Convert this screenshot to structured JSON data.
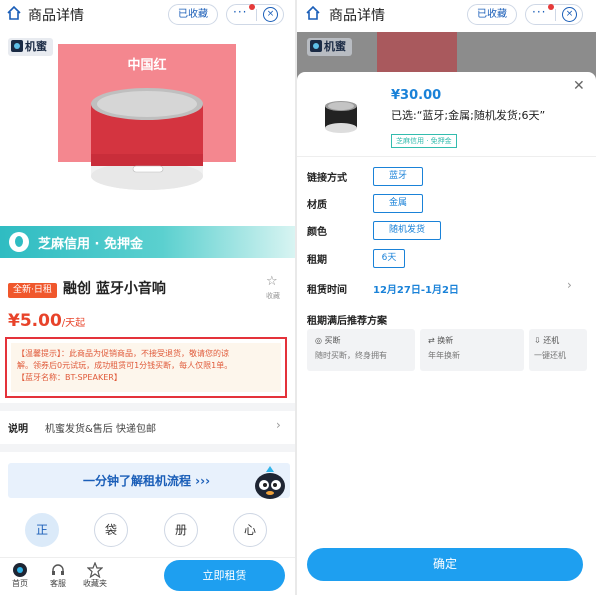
{
  "left": {
    "header": {
      "title": "商品详情",
      "fav_label": "已收藏",
      "more_icon": "more-icon",
      "close_icon": "close-icon"
    },
    "hero": {
      "logo_text": "机蜜",
      "banner_text": "中国红"
    },
    "sesame": {
      "text": "芝麻信用 · 免押金"
    },
    "product": {
      "tag": "全新·日租",
      "name": "融创 蓝牙小音响",
      "fav_label": "收藏",
      "price": "¥5.00",
      "price_unit": "/天起"
    },
    "notice": {
      "line1": "【温馨提示】：此商品为促销商品，不接受退货，敬请您的谅",
      "line2": "解。领券后0元试玩，成功租赁可1分钱买断，每人仅限1单。",
      "line3": "【蓝牙名称：BT-SPEAKER】"
    },
    "explain": {
      "label": "说明",
      "value": "机蜜发货&售后 快递包邮"
    },
    "banner": {
      "text": "一分钟了解租机流程 ›››"
    },
    "icons": [
      "正",
      "袋",
      "册",
      "心"
    ],
    "bottom": {
      "home": "首页",
      "service": "客服",
      "fav": "收藏夹",
      "rent": "立即租赁"
    }
  },
  "right": {
    "header": {
      "title": "商品详情",
      "fav_label": "已收藏"
    },
    "logo_text": "机蜜",
    "sheet": {
      "price": "¥30.00",
      "selected": "已选:“蓝牙;金属;随机发货;6天”",
      "badge": "芝麻信用 · 免押金",
      "rows": [
        {
          "label": "链接方式",
          "option": "蓝牙"
        },
        {
          "label": "材质",
          "option": "金属"
        },
        {
          "label": "颜色",
          "option": "随机发货"
        },
        {
          "label": "租期",
          "option": "6天"
        }
      ],
      "time_label": "租赁时间",
      "time_value": "12月27日-1月2日",
      "plan_title": "租期满后推荐方案",
      "plans": [
        {
          "title": "买断",
          "desc": "随时买断，终身拥有"
        },
        {
          "title": "换新",
          "desc": "年年换新"
        },
        {
          "title": "还机",
          "desc": "一键还机"
        }
      ],
      "confirm": "确定"
    }
  },
  "colors": {
    "accent": "#1e9ff0",
    "price_red": "#e8432a",
    "notice_border": "#e4323a",
    "sesame": "#2fbcc2"
  }
}
